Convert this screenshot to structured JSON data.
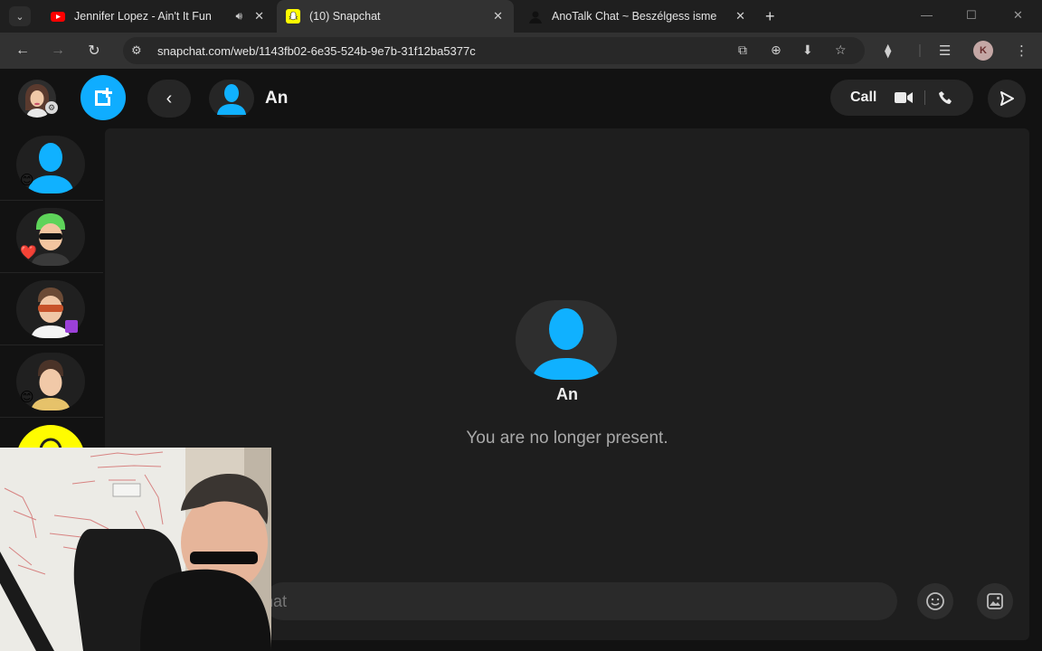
{
  "browser": {
    "tabs": [
      {
        "title": "Jennifer Lopez - Ain't It Fun",
        "favicon": "youtube-icon",
        "audio": true
      },
      {
        "title": "(10) Snapchat",
        "favicon": "snapchat-icon",
        "active": true
      },
      {
        "title": "AnoTalk Chat ~ Beszélgess isme",
        "favicon": "anotalk-icon"
      }
    ],
    "url": "snapchat.com/web/1143fb02-6e35-524b-9e7b-31f12ba5377c",
    "profile_initial": "K"
  },
  "app": {
    "chat_name": "An",
    "call_label": "Call"
  },
  "chat": {
    "contact_name": "An",
    "status": "You are no longer present.",
    "composer_placeholder": "Send a chat",
    "composer_visible": "hat"
  },
  "sidebar": {
    "items": [
      {
        "avatar": "default-avatar",
        "badge": "😊"
      },
      {
        "avatar": "bitmoji-green-hair-sunglasses",
        "badge": "❤️"
      },
      {
        "avatar": "bitmoji-orange-sunglasses",
        "badge": "purple-square"
      },
      {
        "avatar": "bitmoji-brown-hair",
        "badge": "😊"
      },
      {
        "avatar": "bitmoji-yellow",
        "badge": ""
      }
    ]
  },
  "colors": {
    "accent": "#0fadff",
    "background": "#121212",
    "panel": "#1e1e1e"
  }
}
